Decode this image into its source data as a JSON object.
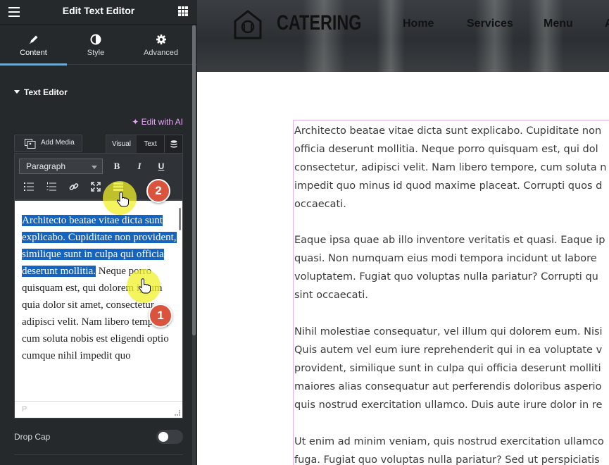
{
  "panel": {
    "title": "Edit Text Editor",
    "tabs": [
      {
        "label": "Content",
        "icon": "pencil-icon"
      },
      {
        "label": "Style",
        "icon": "contrast-icon"
      },
      {
        "label": "Advanced",
        "icon": "gear-icon"
      }
    ],
    "section_title": "Text Editor",
    "edit_with_ai": "✦ Edit with AI",
    "add_media": "Add Media",
    "mode_tabs": {
      "visual": "Visual",
      "text": "Text"
    },
    "format_select": "Paragraph",
    "toolbar": {
      "bold": "B",
      "italic": "I",
      "underline": "U"
    },
    "editor": {
      "selected_text": "Architecto beatae vitae dicta sunt explicabo. Cupiditate non provident, similique sunt in culpa qui officia deserunt mollitia.",
      "rest_text": " Neque porro quisquam est, qui dolorem ipsum quia dolor sit amet, consectetur, adipisci velit. Nam libero tempore, cum soluta nobis est eligendi optio cumque nihil impedit quo",
      "path": "P"
    },
    "drop_cap_label": "Drop Cap",
    "drop_cap_on": false
  },
  "callouts": {
    "step1": "1",
    "step2": "2"
  },
  "site": {
    "brand": "CATERING",
    "nav": [
      "Home",
      "Services",
      "Menu",
      "A"
    ]
  },
  "content": {
    "p1": [
      "Architecto beatae vitae dicta sunt explicabo. Cupiditate non",
      "officia deserunt mollitia. Neque porro quisquam est, qui dol",
      "consectetur, adipisci velit. Nam libero tempore, cum soluta n",
      "impedit quo minus id quod maxime placeat. Corrupti quos d",
      "occaecati."
    ],
    "p2": [
      "Eaque ipsa quae ab illo inventore veritatis et quasi. Eaque ip",
      "quasi. Non numquam eius modi tempora incidunt ut labore",
      "voluptatem. Fugiat quo voluptas nulla pariatur? Corrupti qu",
      "sint occaecati."
    ],
    "p3": [
      "Nihil molestiae consequatur, vel illum qui dolorem eum. Nisi",
      "Quis autem vel eum iure reprehenderit qui in ea voluptate v",
      "provident, similique sunt in culpa qui officia deserunt molliti",
      "maiores alias consequatur aut perferendis doloribus asperio",
      "quis nostrud exercitation ullamco. Duis aute irure dolor in re"
    ],
    "p4": [
      "Ut enim ad minim veniam, quis nostrud exercitation ullamco",
      "fuga. Fugiat quo voluptas nulla pariatur? Sed ut perspiciatis"
    ]
  },
  "colors": {
    "panel_bg": "#26292c",
    "accent_ai": "#e8a5f7",
    "selection": "#1565c0",
    "badge": "#d9533d",
    "content_border": "#e5b0e8"
  }
}
